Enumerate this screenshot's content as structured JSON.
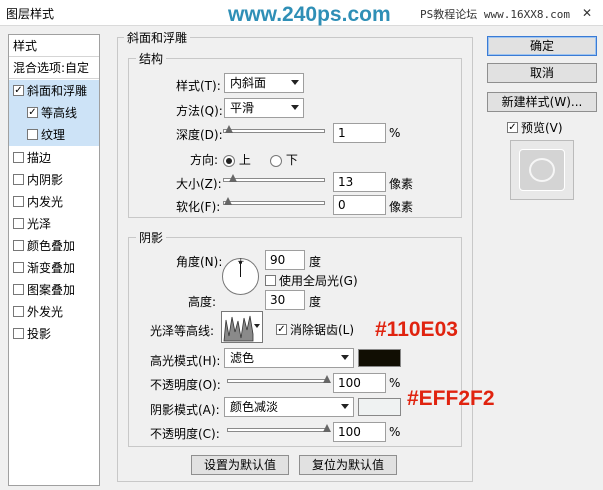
{
  "window": {
    "title": "图层样式",
    "close": "✕"
  },
  "watermark": {
    "main": "www.240ps.com",
    "site": "PS教程论坛 www.16XX8.com"
  },
  "style_list": {
    "header": "样式",
    "blend": "混合选项:自定",
    "items": [
      {
        "label": "斜面和浮雕",
        "checked": "✓"
      },
      {
        "label": "等高线",
        "checked": "✓"
      },
      {
        "label": "纹理",
        "checked": ""
      },
      {
        "label": "描边",
        "checked": ""
      },
      {
        "label": "内阴影",
        "checked": ""
      },
      {
        "label": "内发光",
        "checked": ""
      },
      {
        "label": "光泽",
        "checked": ""
      },
      {
        "label": "颜色叠加",
        "checked": ""
      },
      {
        "label": "渐变叠加",
        "checked": ""
      },
      {
        "label": "图案叠加",
        "checked": ""
      },
      {
        "label": "外发光",
        "checked": ""
      },
      {
        "label": "投影",
        "checked": ""
      }
    ]
  },
  "bevel": {
    "title": "斜面和浮雕",
    "structure": {
      "title": "结构",
      "style_label": "样式(T):",
      "style_value": "内斜面",
      "method_label": "方法(Q):",
      "method_value": "平滑",
      "depth_label": "深度(D):",
      "depth_value": "1",
      "depth_unit": "%",
      "depth_level_pct": 1,
      "direction_label": "方向:",
      "dir_up": "上",
      "dir_down": "下",
      "size_label": "大小(Z):",
      "size_value": "13",
      "size_unit": "像素",
      "size_level_pct": 5,
      "soften_label": "软化(F):",
      "soften_value": "0",
      "soften_unit": "像素",
      "soften_level_pct": 0
    },
    "shading": {
      "title": "阴影",
      "angle_label": "角度(N):",
      "angle_value": "90",
      "angle_unit": "度",
      "global_light_label": "使用全局光(G)",
      "altitude_label": "高度:",
      "altitude_value": "30",
      "altitude_unit": "度",
      "gloss_label": "光泽等高线:",
      "antialias_label": "消除锯齿(L)",
      "antialias_checked": "✓",
      "highlight_label": "高光模式(H):",
      "highlight_mode": "滤色",
      "highlight_color": "#110E03",
      "opacity1_label": "不透明度(O):",
      "opacity1_value": "100",
      "opacity1_unit": "%",
      "shadow_label": "阴影模式(A):",
      "shadow_mode": "颜色减淡",
      "shadow_color": "#EFF2F2",
      "opacity2_label": "不透明度(C):",
      "opacity2_value": "100",
      "opacity2_unit": "%"
    },
    "default_button": "设置为默认值",
    "reset_button": "复位为默认值"
  },
  "annotations": {
    "highlight_hex": "#110E03",
    "shadow_hex": "#EFF2F2"
  },
  "buttons": {
    "ok": "确定",
    "cancel": "取消",
    "new_style": "新建样式(W)...",
    "preview": "预览(V)",
    "preview_checked": "✓"
  }
}
